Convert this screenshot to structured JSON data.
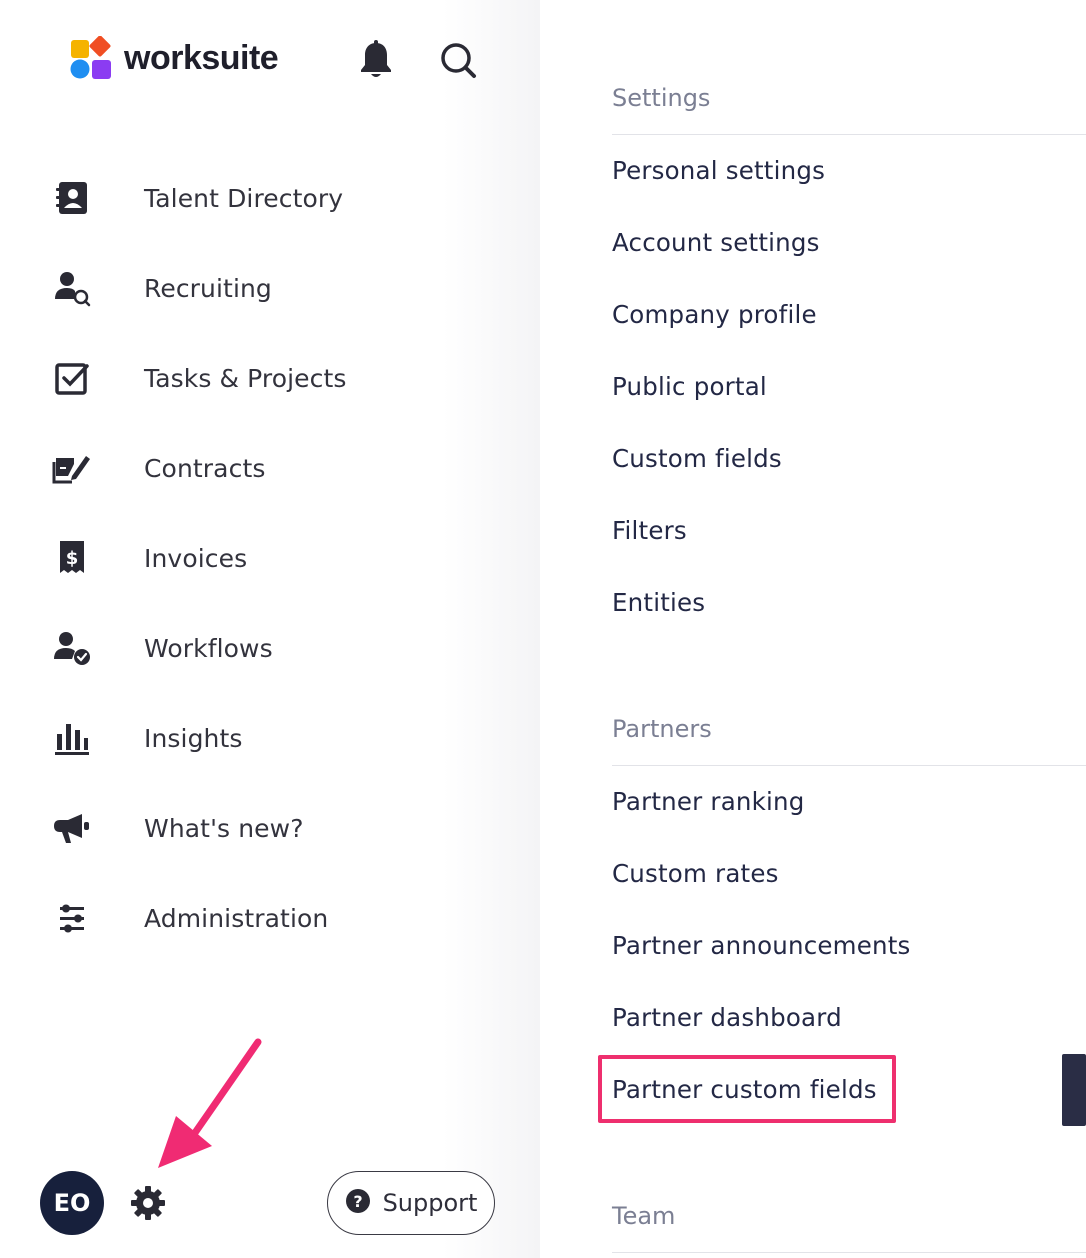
{
  "app": {
    "name": "worksuite",
    "brand_colors": [
      "#f5b300",
      "#f04e23",
      "#1f8ef1",
      "#8b3cf2"
    ]
  },
  "sidebar": {
    "items": [
      {
        "label": "Talent Directory",
        "icon": "contact-book-icon"
      },
      {
        "label": "Recruiting",
        "icon": "user-search-icon"
      },
      {
        "label": "Tasks & Projects",
        "icon": "checkbox-icon"
      },
      {
        "label": "Contracts",
        "icon": "contract-sign-icon"
      },
      {
        "label": "Invoices",
        "icon": "invoice-dollar-icon"
      },
      {
        "label": "Workflows",
        "icon": "user-check-icon"
      },
      {
        "label": "Insights",
        "icon": "bar-chart-icon"
      },
      {
        "label": "What's new?",
        "icon": "megaphone-icon"
      },
      {
        "label": "Administration",
        "icon": "sliders-icon"
      }
    ],
    "avatar_initials": "EO",
    "support_label": "Support"
  },
  "panel": {
    "sections": [
      {
        "title": "Settings",
        "items": [
          "Personal settings",
          "Account settings",
          "Company profile",
          "Public portal",
          "Custom fields",
          "Filters",
          "Entities"
        ]
      },
      {
        "title": "Partners",
        "items": [
          "Partner ranking",
          "Custom rates",
          "Partner announcements",
          "Partner dashboard",
          "Partner custom fields"
        ]
      },
      {
        "title": "Team",
        "items": []
      }
    ],
    "highlighted_item": "Partner custom fields",
    "highlight_color": "#ee2f6e"
  }
}
